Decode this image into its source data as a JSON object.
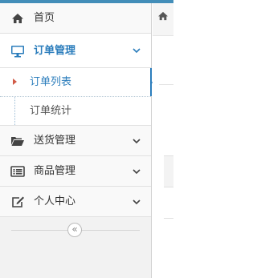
{
  "sidebar": {
    "home": {
      "label": "首页",
      "icon": "home-icon"
    },
    "orders": {
      "label": "订单管理",
      "icon": "desktop-icon",
      "expanded": true,
      "children": [
        {
          "label": "订单列表",
          "active": true
        },
        {
          "label": "订单统计",
          "active": false
        }
      ]
    },
    "shipping": {
      "label": "送货管理",
      "icon": "folder-open-icon"
    },
    "products": {
      "label": "商品管理",
      "icon": "list-alt-icon"
    },
    "profile": {
      "label": "个人中心",
      "icon": "edit-icon"
    },
    "collapse_icon": "double-chevron-left-icon"
  },
  "colors": {
    "accent": "#2b7dbc",
    "header": "#438eb9",
    "marker": "#d15b47"
  }
}
